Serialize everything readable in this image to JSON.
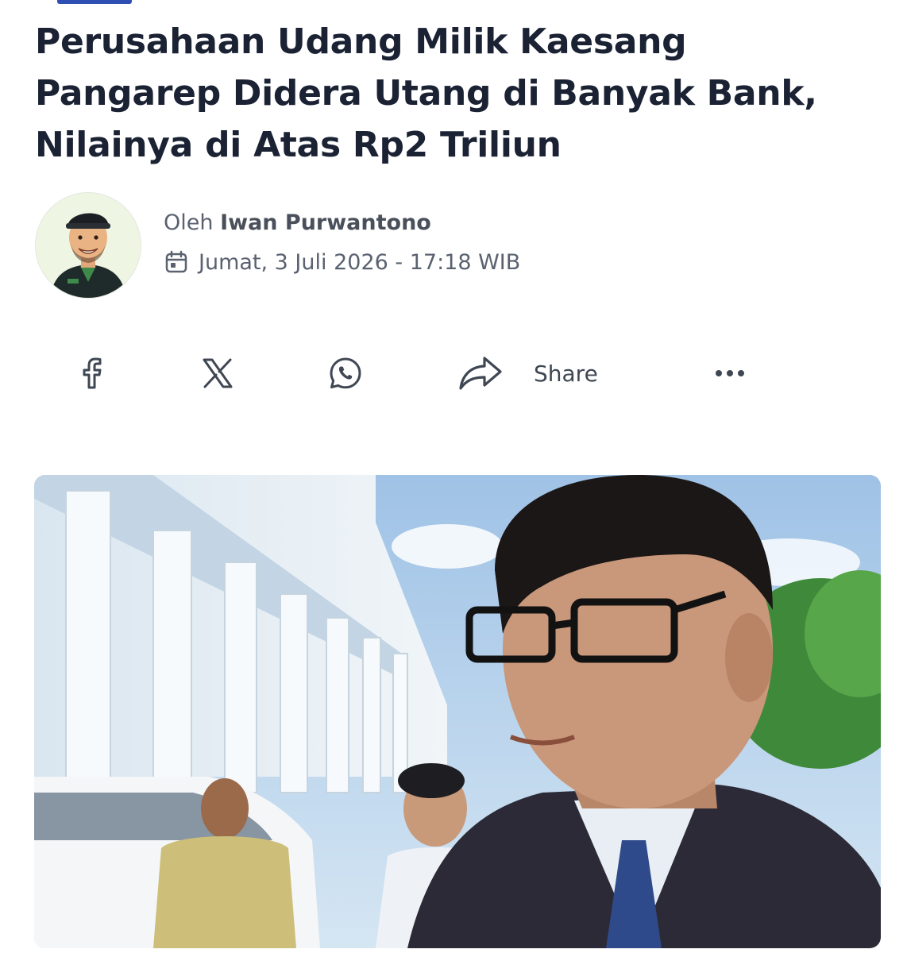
{
  "article": {
    "headline": "Perusahaan Udang Milik Kaesang Pangarep Didera Utang di Banyak Bank, Nilainya di Atas Rp2 Triliun",
    "byline_prefix": "Oleh",
    "author": "Iwan Purwantono",
    "date": "Jumat, 3 Juli 2026 - 17:18 WIB"
  },
  "share": {
    "icons": [
      "facebook-icon",
      "x-icon",
      "whatsapp-icon",
      "share-arrow-icon",
      "more-icon"
    ],
    "share_label": "Share"
  },
  "colors": {
    "accent": "#2f4fb4",
    "headline": "#1a2233",
    "meta": "#5a6270"
  }
}
